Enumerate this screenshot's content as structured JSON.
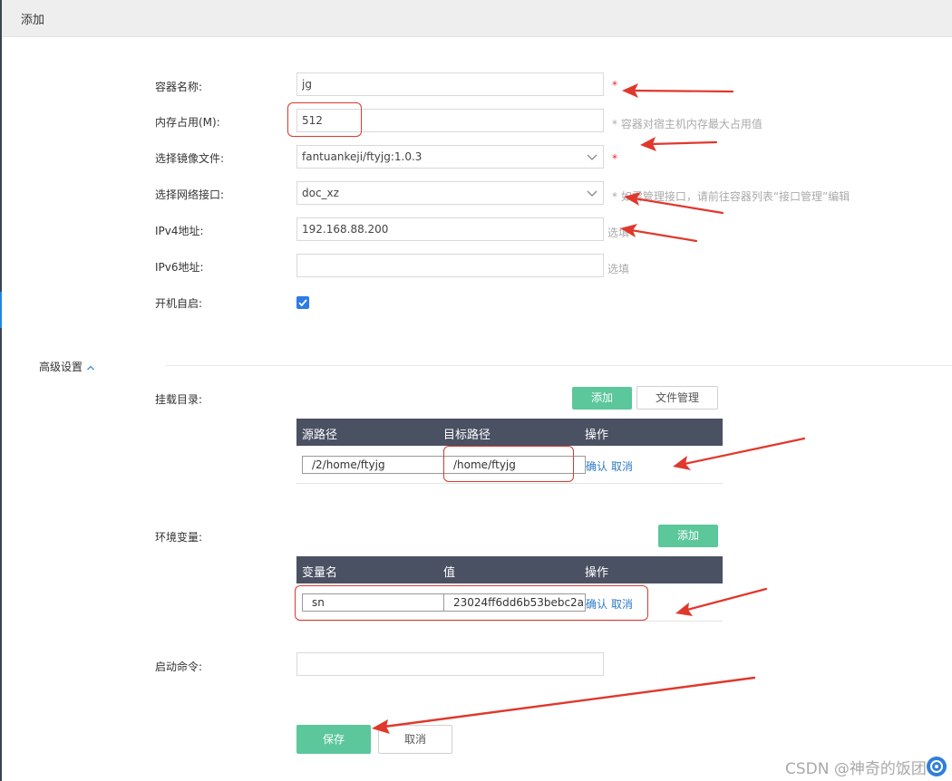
{
  "dialog": {
    "title": "添加"
  },
  "form": {
    "name": {
      "label": "容器名称:",
      "value": "jg",
      "required": "*"
    },
    "memory": {
      "label": "内存占用(M):",
      "value": "512",
      "hint": "* 容器对宿主机内存最大占用值"
    },
    "image": {
      "label": "选择镜像文件:",
      "value": "fantuankeji/ftyjg:1.0.3",
      "required": "*"
    },
    "network": {
      "label": "选择网络接口:",
      "value": "doc_xz",
      "hint": "* 如需管理接口，请前往容器列表“接口管理”编辑"
    },
    "ipv4": {
      "label": "IPv4地址:",
      "value": "192.168.88.200",
      "hint": "选填"
    },
    "ipv6": {
      "label": "IPv6地址:",
      "value": "",
      "hint": "选填"
    },
    "autostart": {
      "label": "开机自启:",
      "checked": true
    }
  },
  "advanced": {
    "toggle_label": "高级设置",
    "mount": {
      "label": "挂载目录:",
      "add_label": "添加",
      "file_mgmt_label": "文件管理",
      "columns": [
        "源路径",
        "目标路径",
        "操作"
      ],
      "rows": [
        {
          "source": "/2/home/ftyjg",
          "target": "/home/ftyjg",
          "confirm": "确认",
          "cancel": "取消"
        }
      ]
    },
    "env": {
      "label": "环境变量:",
      "add_label": "添加",
      "columns": [
        "变量名",
        "值",
        "操作"
      ],
      "rows": [
        {
          "name": "sn",
          "value": "23024ff6dd6b53bebc2a",
          "confirm": "确认",
          "cancel": "取消"
        }
      ]
    },
    "command": {
      "label": "启动命令:",
      "value": ""
    }
  },
  "actions": {
    "save_label": "保存",
    "cancel_label": "取消"
  },
  "watermark": "CSDN @神奇的饭团",
  "colors": {
    "primary_green": "#5bc79b",
    "table_header": "#4a5163",
    "link_blue": "#2d7bc4",
    "annotation_red": "#e0382c",
    "checkbox_blue": "#2c7be5"
  }
}
